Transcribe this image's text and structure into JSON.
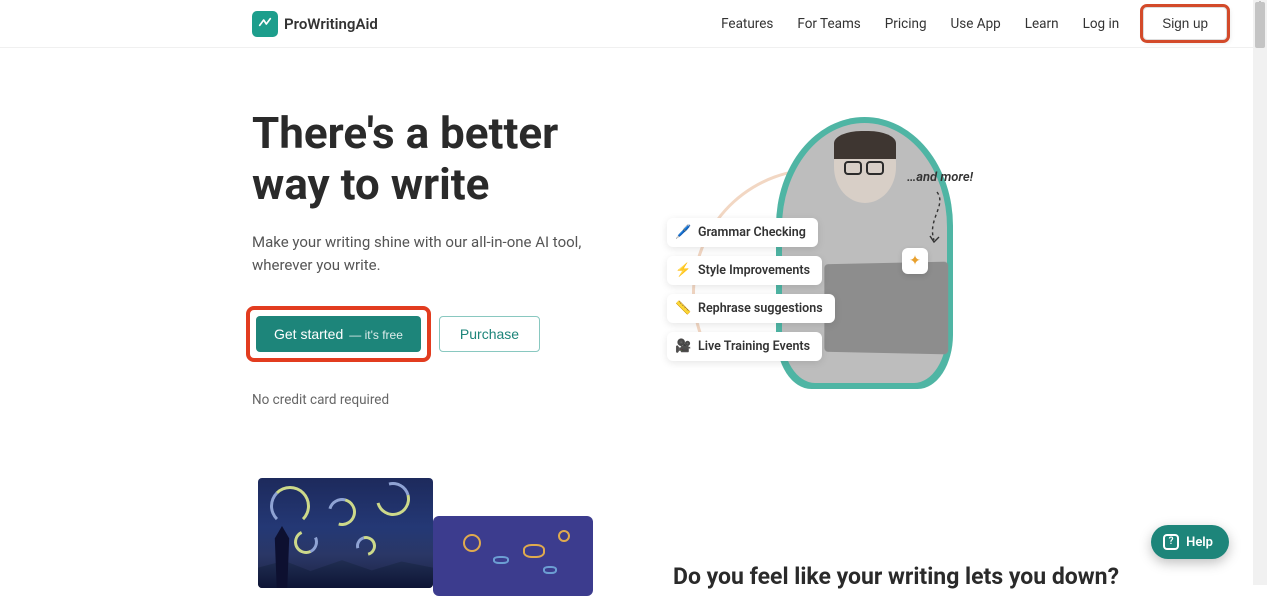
{
  "brand": {
    "name": "ProWritingAid"
  },
  "nav": {
    "features": "Features",
    "for_teams": "For Teams",
    "pricing": "Pricing",
    "use_app": "Use App",
    "learn": "Learn",
    "log_in": "Log in",
    "sign_up": "Sign up"
  },
  "hero": {
    "title": "There's a better way to write",
    "subtitle": "Make your writing shine with our all-in-one AI tool, wherever you write.",
    "cta_primary": "Get started",
    "cta_primary_sub": "— it's free",
    "cta_secondary": "Purchase",
    "note": "No credit card required"
  },
  "feature_pills": [
    {
      "icon": "🖊️",
      "label": "Grammar Checking"
    },
    {
      "icon": "⚡",
      "label": "Style Improvements"
    },
    {
      "icon": "📏",
      "label": "Rephrase suggestions"
    },
    {
      "icon": "🎥",
      "label": "Live Training Events"
    }
  ],
  "and_more": "…and more!",
  "section2": {
    "heading": "Do you feel like your writing lets you down?"
  },
  "help": {
    "label": "Help"
  },
  "colors": {
    "brand_teal": "#1d857a",
    "highlight_red": "#e23c1f"
  }
}
